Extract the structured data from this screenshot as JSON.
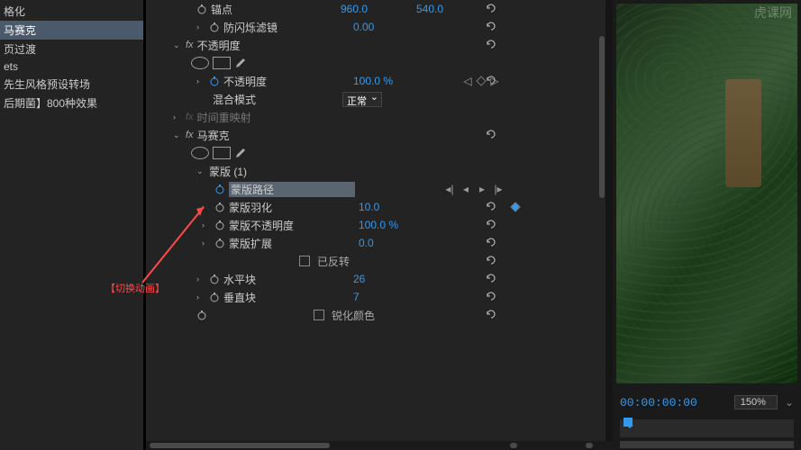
{
  "watermark": "虎课网",
  "left_panel": {
    "items": [
      {
        "label": "格化",
        "selected": false
      },
      {
        "label": "马赛克",
        "selected": true
      },
      {
        "label": "页过渡",
        "selected": false
      },
      {
        "label": "ets",
        "selected": false
      },
      {
        "label": "先生风格预设转场",
        "selected": false
      },
      {
        "label": "后期菌】800种效果",
        "selected": false
      }
    ]
  },
  "props": {
    "row0": {
      "sw": true,
      "label": "锚点",
      "val1": "960.0",
      "val2": "540.0"
    },
    "row1": {
      "sw": true,
      "label": "防闪烁滤镜",
      "val": "0.00"
    },
    "opacity": {
      "label": "不透明度"
    },
    "opacity_val": {
      "label": "不透明度",
      "val": "100.0 %"
    },
    "blend": {
      "label": "混合模式",
      "val": "正常"
    },
    "time_remap": {
      "label": "时间重映射"
    },
    "mosaic": {
      "label": "马赛克"
    },
    "mask1": {
      "label": "蒙版 (1)"
    },
    "mask_path": {
      "label": "蒙版路径"
    },
    "mask_feather": {
      "label": "蒙版羽化",
      "val": "10.0"
    },
    "mask_opacity": {
      "label": "蒙版不透明度",
      "val": "100.0 %"
    },
    "mask_expand": {
      "label": "蒙版扩展",
      "val": "0.0"
    },
    "inverted": {
      "label": "已反转"
    },
    "hblocks": {
      "label": "水平块",
      "val": "26"
    },
    "vblocks": {
      "label": "垂直块",
      "val": "7"
    },
    "sharpen": {
      "label": "锐化颜色"
    }
  },
  "annotation": {
    "text": "【切换动画】"
  },
  "preview": {
    "timecode": "00:00:00:00",
    "zoom": "150%"
  }
}
